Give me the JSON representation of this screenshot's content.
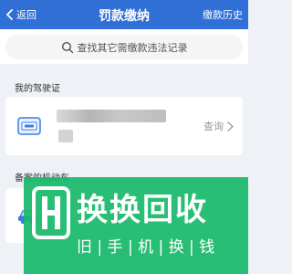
{
  "nav": {
    "back_label": "返回",
    "title": "罚款缴纳",
    "history_label": "缴款历史",
    "color": "#2f6fd6"
  },
  "search": {
    "placeholder": "查找其它需缴款违法记录",
    "icon": "search-icon"
  },
  "license_section": {
    "title": "我的驾驶证",
    "card": {
      "icon": "driver-license-icon",
      "action_label": "查询"
    }
  },
  "vehicle_section": {
    "title": "备案的机动车",
    "card": {
      "icon": "car-icon"
    }
  },
  "watermark": {
    "brand": "换换回收",
    "slogan": "旧手机换钱",
    "color": "#17b969"
  }
}
